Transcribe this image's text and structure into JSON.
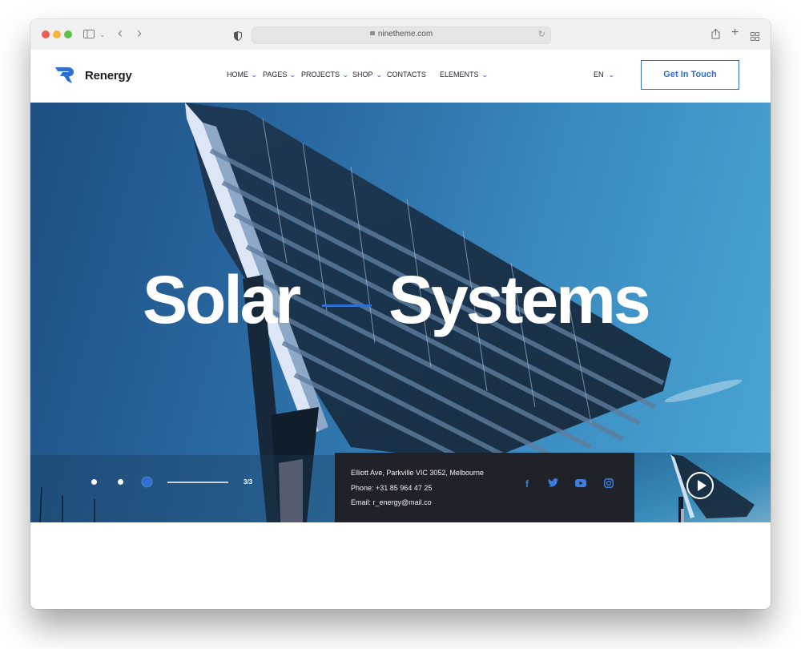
{
  "browser": {
    "url": "ninetheme.com",
    "traffic_lights": [
      "close",
      "minimize",
      "zoom"
    ],
    "toolbar_icons": [
      "sidebar-icon",
      "chevron-down-icon",
      "back-icon",
      "forward-icon",
      "shield-icon",
      "lock-icon",
      "reload-icon",
      "share-icon",
      "new-tab-icon",
      "tab-overview-icon"
    ]
  },
  "header": {
    "brand": "Renergy",
    "brand_color": "#2f6fd1",
    "nav": [
      {
        "label": "HOME",
        "dropdown": true,
        "active": true
      },
      {
        "label": "PAGES",
        "dropdown": true
      },
      {
        "label": "PROJECTS",
        "dropdown": true
      },
      {
        "label": "SHOP",
        "dropdown": true
      },
      {
        "label": "CONTACTS",
        "dropdown": false
      },
      {
        "label": "ELEMENTS",
        "dropdown": true
      }
    ],
    "language": "EN",
    "cta_label": "Get In Touch"
  },
  "hero": {
    "title_word_1": "Solar",
    "title_word_2": "Systems",
    "slides_total": 3,
    "current_slide": 3,
    "counter": "3/3"
  },
  "contact": {
    "address": "Elliott Ave, Parkville VIC 3052, Melbourne",
    "phone": "Phone: +31 85 964 47 25",
    "email": "Email: r_energy@mail.co",
    "social": [
      "facebook-icon",
      "twitter-icon",
      "youtube-icon",
      "instagram-icon"
    ]
  },
  "video": {
    "play_label": "Play video"
  },
  "icons": {
    "chevron": "⌄",
    "facebook": "f",
    "twitter": "🐦",
    "youtube": "▶",
    "instagram": "◎",
    "sidebar": "▭",
    "back": "‹",
    "forward": "›",
    "share": "⇪",
    "plus": "+",
    "grid": "▦",
    "reload": "↻"
  }
}
